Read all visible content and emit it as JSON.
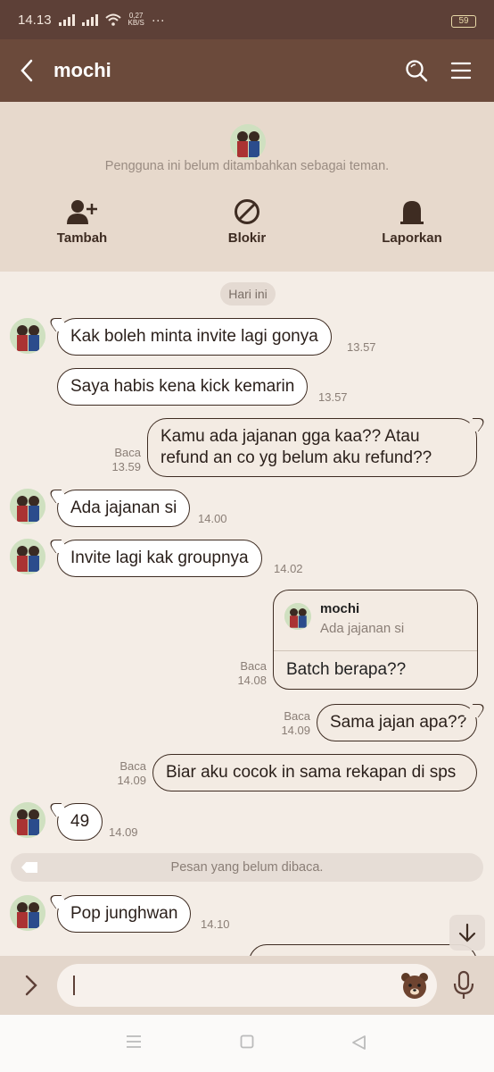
{
  "status": {
    "time": "14.13",
    "netspeed_value": "0,27",
    "netspeed_unit": "KB/S",
    "more": "···",
    "battery": "59"
  },
  "header": {
    "title": "mochi"
  },
  "notice": {
    "text": "Pengguna ini belum ditambahkan sebagai teman.",
    "add_label": "Tambah",
    "block_label": "Blokir",
    "report_label": "Laporkan"
  },
  "chat": {
    "date": "Hari ini",
    "messages": [
      {
        "dir": "in",
        "text": "Kak boleh minta invite lagi gonya",
        "time": "13.57"
      },
      {
        "dir": "in",
        "text": "Saya habis kena kick kemarin",
        "time": "13.57"
      },
      {
        "dir": "out",
        "text": "Kamu ada jajanan gga kaa?? Atau refund an co yg belum aku refund??",
        "read": "Baca",
        "time": "13.59"
      },
      {
        "dir": "in",
        "text": "Ada jajanan si",
        "time": "14.00"
      },
      {
        "dir": "in",
        "text": "Invite lagi kak groupnya",
        "time": "14.02"
      },
      {
        "dir": "out",
        "reply_name": "mochi",
        "reply_text": "Ada jajanan si",
        "text": "Batch berapa??",
        "read": "Baca",
        "time": "14.08"
      },
      {
        "dir": "out",
        "text": "Sama jajan apa??",
        "read": "Baca",
        "time": "14.09"
      },
      {
        "dir": "out",
        "text": "Biar aku cocok in sama rekapan di sps",
        "read": "Baca",
        "time": "14.09"
      },
      {
        "dir": "in",
        "text": "49",
        "time": "14.09"
      },
      {
        "dir": "in",
        "text": "Pop junghwan",
        "time": "14.10"
      }
    ],
    "unread_label": "Pesan yang belum dibaca."
  },
  "colors": {
    "header": "#6b4a3b",
    "statusbar": "#5d4037",
    "background": "#f4ede6",
    "bubble_border": "#3e2c22"
  },
  "icons": [
    "back-icon",
    "search-icon",
    "menu-icon",
    "add-friend-icon",
    "block-icon",
    "report-icon",
    "arrow-down-icon",
    "expand-icon",
    "sticker-bear-icon",
    "mic-icon"
  ]
}
